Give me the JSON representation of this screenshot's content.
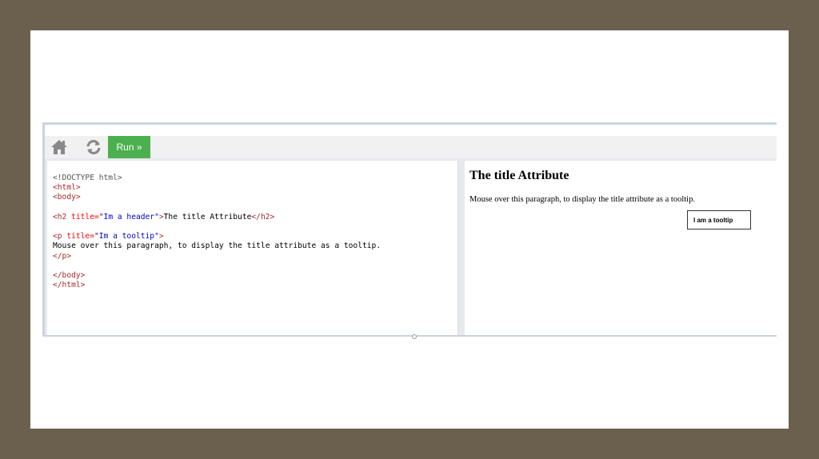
{
  "toolbar": {
    "home_icon": "home-icon",
    "refresh_icon": "refresh-icon",
    "run_label": "Run »"
  },
  "code": {
    "lines": [
      [
        {
          "t": "doctype",
          "s": "<!DOCTYPE html>"
        }
      ],
      [
        {
          "t": "tag",
          "s": "<html>"
        }
      ],
      [
        {
          "t": "tag",
          "s": "<body>"
        }
      ],
      [],
      [
        {
          "t": "tag",
          "s": "<h2 "
        },
        {
          "t": "attr",
          "s": "title="
        },
        {
          "t": "val",
          "s": "\"Im a header\""
        },
        {
          "t": "tag",
          "s": ">"
        },
        {
          "t": "plain",
          "s": "The title Attribute"
        },
        {
          "t": "tag",
          "s": "</h2>"
        }
      ],
      [],
      [
        {
          "t": "tag",
          "s": "<p "
        },
        {
          "t": "attr",
          "s": "title="
        },
        {
          "t": "val",
          "s": "\"Im a tooltip\""
        },
        {
          "t": "tag",
          "s": ">"
        }
      ],
      [
        {
          "t": "plain",
          "s": "Mouse over this paragraph, to display the title attribute as a tooltip."
        }
      ],
      [
        {
          "t": "tag",
          "s": "</p>"
        }
      ],
      [],
      [
        {
          "t": "tag",
          "s": "</body>"
        }
      ],
      [
        {
          "t": "tag",
          "s": "</html>"
        }
      ]
    ]
  },
  "result": {
    "heading": "The title Attribute",
    "paragraph": "Mouse over this paragraph, to display the title attribute as a tooltip.",
    "tooltip": "I am a tooltip"
  },
  "colors": {
    "run_button": "#4caf50",
    "frame_border": "#c9d3de",
    "toolbar_bg": "#f1f1f1",
    "outer_bg": "#6b5f4e"
  }
}
